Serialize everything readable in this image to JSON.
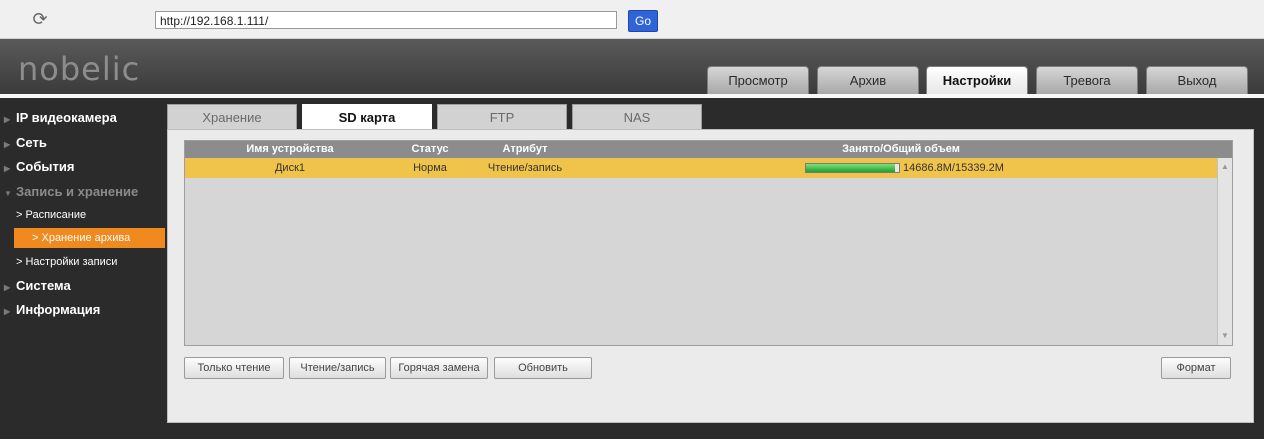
{
  "browser": {
    "url": "http://192.168.1.111/",
    "go_label": "Go"
  },
  "app": {
    "logo": "nobelic"
  },
  "nav_tabs": [
    {
      "label": "Просмотр"
    },
    {
      "label": "Архив"
    },
    {
      "label": "Настройки",
      "active": true
    },
    {
      "label": "Тревога"
    },
    {
      "label": "Выход"
    }
  ],
  "sidebar": {
    "items": [
      {
        "label": "IP видеокамера"
      },
      {
        "label": "Сеть"
      },
      {
        "label": "События"
      },
      {
        "label": "Запись и хранение"
      },
      {
        "label": "Расписание"
      },
      {
        "label": "Хранение архива"
      },
      {
        "label": "Настройки записи"
      },
      {
        "label": "Система"
      },
      {
        "label": "Информация"
      }
    ]
  },
  "sub_tabs": [
    {
      "label": "Хранение"
    },
    {
      "label": "SD карта",
      "active": true
    },
    {
      "label": "FTP"
    },
    {
      "label": "NAS"
    }
  ],
  "table": {
    "headers": [
      "Имя устройства",
      "Статус",
      "Атрибут",
      "Занято/Общий объем"
    ],
    "rows": [
      {
        "name": "Диск1",
        "status": "Норма",
        "attribute": "Чтение/запись",
        "usage": "14686.8M/15339.2M",
        "usage_fraction": 0.957
      }
    ]
  },
  "buttons": {
    "read_only": "Только чтение",
    "read_write": "Чтение/запись",
    "hot_swap": "Горячая замена",
    "refresh": "Обновить",
    "format": "Формат"
  },
  "colors": {
    "accent": "#f08a1e",
    "row_highlight": "#f0c34a",
    "go_button": "#2f63d8"
  }
}
